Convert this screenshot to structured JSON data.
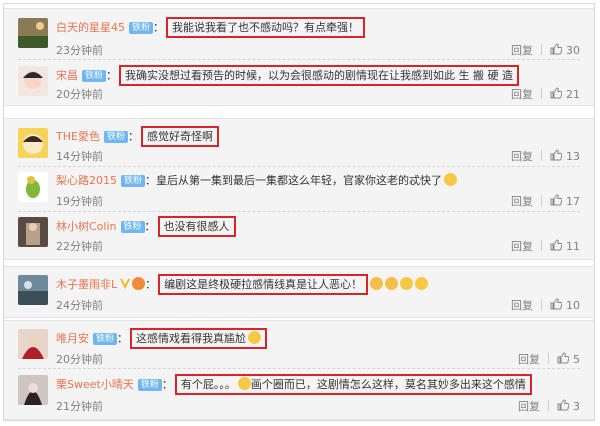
{
  "comments": [
    {
      "user": "白天的星星45",
      "fan": "铁粉",
      "text": "我能说我看了也不感动吗？有点牵强！",
      "time": "23分钟前",
      "reply": "回复",
      "likes": "30"
    },
    {
      "user": "宋昌",
      "fan": "铁粉",
      "text": "我确实没想过看预告的时候，以为会很感动的剧情现在让我感到如此 生 搬 硬 造",
      "time": "20分钟前",
      "reply": "回复",
      "likes": "21"
    },
    {
      "user": "THE愛色",
      "fan": "铁粉",
      "text": "感觉好奇怪啊",
      "time": "14分钟前",
      "reply": "回复",
      "likes": "13"
    },
    {
      "user": "梨心路2015",
      "fan": "铁粉",
      "text": "皇后从第一集到最后一集都这么年轻，官家你这老的忒快了",
      "time": "19分钟前",
      "reply": "回复",
      "likes": "17"
    },
    {
      "user": "林小树Colin",
      "fan": "铁粉",
      "text": "也没有很感人",
      "time": "22分钟前",
      "reply": "回复",
      "likes": "11"
    },
    {
      "user": "木子墨雨非L",
      "fan": "",
      "text": "编剧这是终极硬拉感情线真是让人恶心！",
      "time": "24分钟前",
      "reply": "回复",
      "likes": "10"
    },
    {
      "user": "唯月安",
      "fan": "铁粉",
      "text": "这感情戏看得我真尴尬",
      "time": "20分钟前",
      "reply": "回复",
      "likes": "5"
    },
    {
      "user": "栗Sweet小晴天",
      "fan": "铁粉",
      "text_a": "有个屁。。。",
      "text_b": "画个圈而已，这剧情怎么这样，莫名其妙多出来这个感情",
      "time": "21分钟前",
      "reply": "回复",
      "likes": "3"
    }
  ],
  "colors": {
    "username": "#eb7350",
    "highlight": "#d6262b",
    "fan_badge": "#6fb6f2"
  }
}
